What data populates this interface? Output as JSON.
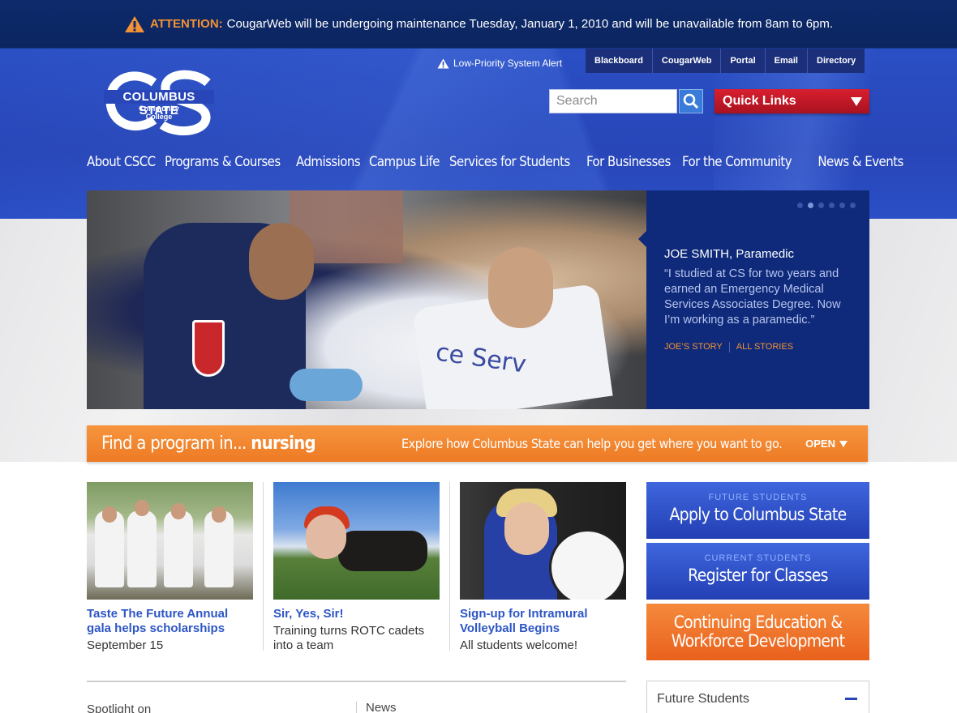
{
  "alert": {
    "label": "ATTENTION:",
    "message": "CougarWeb will be undergoing maintenance Tuesday, January 1, 2010 and will be unavailable from 8am to 6pm."
  },
  "logo": {
    "name": "COLUMBUS STATE",
    "sub1": "Community",
    "sub2": "College"
  },
  "system_alert": "Low-Priority System Alert",
  "utility_links": [
    "Blackboard",
    "CougarWeb",
    "Portal",
    "Email",
    "Directory"
  ],
  "search": {
    "placeholder": "Search"
  },
  "quick_links": "Quick Links",
  "nav": [
    "About CSCC",
    "Programs & Courses",
    "Admissions",
    "Campus Life",
    "Services for Students",
    "For Businesses",
    "For the Community",
    "News & Events"
  ],
  "hero": {
    "name": "JOE SMITH",
    "role": ", Paramedic",
    "quote": "“I studied at CS for two years and earned an Emergency Medical Services Associates Degree. Now I’m working as a paramedic.”",
    "link1": "JOE’S STORY",
    "link2": "ALL STORIES",
    "photo_text": "ce Serv",
    "slide_count": 6,
    "active_slide": 2
  },
  "find": {
    "prefix": "Find a program in...",
    "keyword": "nursing",
    "explore": "Explore how Columbus State can help you get where you want to go.",
    "open": "OPEN"
  },
  "cards": [
    {
      "title": "Taste The Future Annual gala helps scholarships",
      "sub": "September 15"
    },
    {
      "title": "Sir, Yes, Sir!",
      "sub": "Training turns ROTC cadets into a team"
    },
    {
      "title": "Sign-up for Intramural Volleyball Begins",
      "sub": "All students welcome!"
    }
  ],
  "cta": {
    "apply_kicker": "FUTURE STUDENTS",
    "apply_main": "Apply to Columbus State",
    "register_kicker": "CURRENT STUDENTS",
    "register_main": "Register for Classes",
    "ce_line1": "Continuing Education &",
    "ce_line2": "Workforce Development"
  },
  "bottom": {
    "spotlight": "Spotlight on",
    "news": "News",
    "future_students": "Future Students"
  },
  "colors": {
    "brand_blue": "#2846b8",
    "accent_orange": "#f39234",
    "quick_links_red": "#d81f2f"
  }
}
